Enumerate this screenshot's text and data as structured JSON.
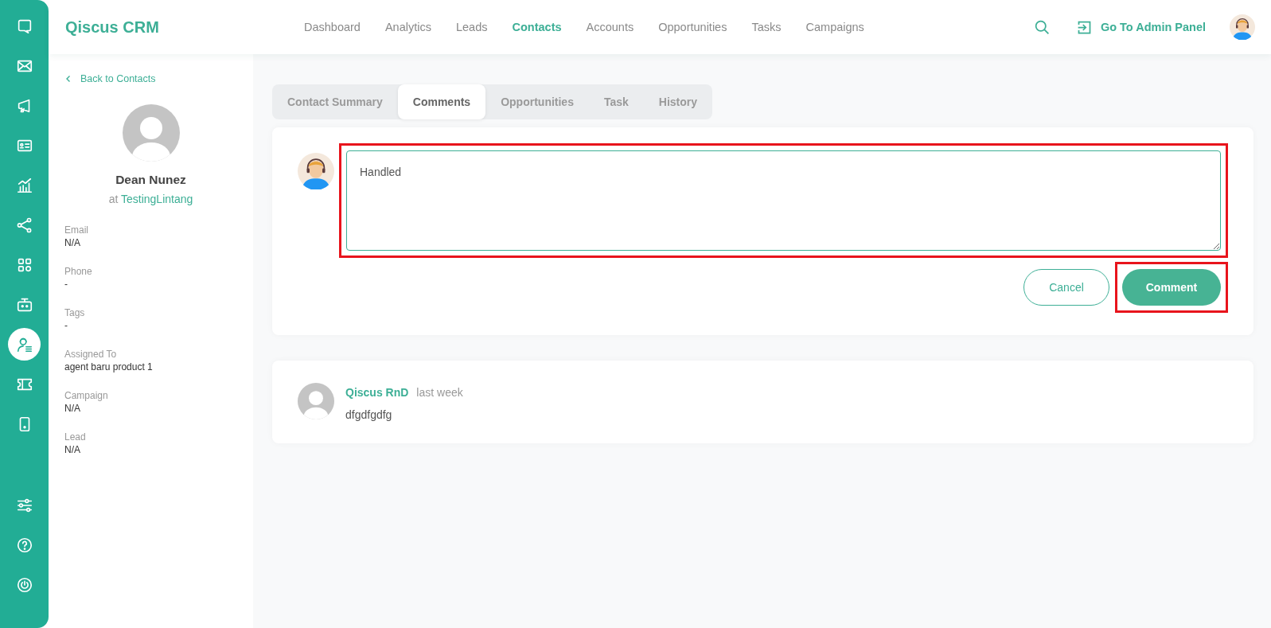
{
  "rail": [
    {
      "kind": "chat",
      "selected": false
    },
    {
      "kind": "mail",
      "selected": false
    },
    {
      "kind": "megaphone",
      "selected": false
    },
    {
      "kind": "card",
      "selected": false
    },
    {
      "kind": "chart",
      "selected": false
    },
    {
      "kind": "share",
      "selected": false
    },
    {
      "kind": "apps",
      "selected": false
    },
    {
      "kind": "robot",
      "selected": false
    },
    {
      "kind": "contact",
      "selected": true
    },
    {
      "kind": "ticket",
      "selected": false
    },
    {
      "kind": "phone",
      "selected": false
    }
  ],
  "rail_bottom": [
    {
      "kind": "sliders",
      "selected": false
    },
    {
      "kind": "help",
      "selected": false
    },
    {
      "kind": "power",
      "selected": false
    }
  ],
  "brand": "Qiscus CRM",
  "nav": [
    {
      "label": "Dashboard",
      "selected": false
    },
    {
      "label": "Analytics",
      "selected": false
    },
    {
      "label": "Leads",
      "selected": false
    },
    {
      "label": "Contacts",
      "selected": true
    },
    {
      "label": "Accounts",
      "selected": false
    },
    {
      "label": "Opportunities",
      "selected": false
    },
    {
      "label": "Tasks",
      "selected": false
    },
    {
      "label": "Campaigns",
      "selected": false
    }
  ],
  "admin_link": "Go To Admin Panel",
  "back_link": "Back to Contacts",
  "contact": {
    "name": "Dean Nunez",
    "at": "at",
    "company": "TestingLintang"
  },
  "fields": [
    {
      "label": "Email",
      "value": "N/A"
    },
    {
      "label": "Phone",
      "value": "-"
    },
    {
      "label": "Tags",
      "value": "-"
    },
    {
      "label": "Assigned To",
      "value": "agent baru product 1"
    },
    {
      "label": "Campaign",
      "value": "N/A"
    },
    {
      "label": "Lead",
      "value": "N/A"
    }
  ],
  "tabs": [
    {
      "label": "Contact Summary",
      "selected": false
    },
    {
      "label": "Comments",
      "selected": true
    },
    {
      "label": "Opportunities",
      "selected": false
    },
    {
      "label": "Task",
      "selected": false
    },
    {
      "label": "History",
      "selected": false
    }
  ],
  "comment_input": {
    "value": "Handled",
    "highlighted": true
  },
  "cancel_button": {
    "label": "Cancel",
    "highlighted": false
  },
  "comment_button": {
    "label": "Comment",
    "highlighted": true
  },
  "comments": [
    {
      "author": "Qiscus RnD",
      "time": "last week",
      "text": "dfgdfgdfg"
    }
  ]
}
